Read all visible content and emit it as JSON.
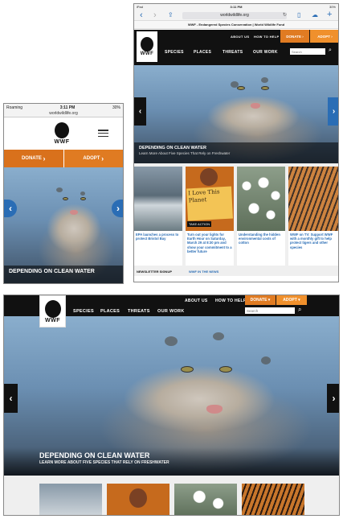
{
  "phone": {
    "status": {
      "carrier": "Roaming",
      "time": "3:11 PM",
      "battery": "30%"
    },
    "url": "worldwildlife.org",
    "logo_text": "WWF",
    "donate_label": "DONATE",
    "adopt_label": "ADOPT",
    "caption_title": "DEPENDING ON CLEAN WATER"
  },
  "tablet": {
    "status": {
      "device": "iPad",
      "time": "3:11 PM",
      "battery": "30%"
    },
    "url": "worldwildlife.org",
    "page_title": "WWF - Endangered Species Conservation | World Wildlife Fund",
    "top_links": [
      "ABOUT US",
      "HOW TO HELP"
    ],
    "donate_label": "DONATE",
    "adopt_label": "ADOPT",
    "nav": [
      "SPECIES",
      "PLACES",
      "THREATS",
      "OUR WORK"
    ],
    "search_placeholder": "Search",
    "logo_text": "WWF",
    "caption_title": "DEPENDING ON CLEAN WATER",
    "caption_sub": "Learn More About Five Species That Rely on Freshwater",
    "news": [
      {
        "text": "EPA launches a process to protect Bristol Bay"
      },
      {
        "text": "Turn out your lights for Earth Hour on Saturday, March 29 at 8:30 pm and show your commitment to a better future",
        "sign": "I Love This Planet",
        "badge": "TAKE ACTION"
      },
      {
        "text": "Understanding the hidden environmental costs of cotton"
      },
      {
        "text": "WWF on TV: Support WWF with a monthly gift to help protect tigers and other species"
      }
    ],
    "footer_links": [
      "NEWSLETTER SIGNUP",
      "WWF IN THE NEWS"
    ]
  },
  "desktop": {
    "top_links": [
      "ABOUT US",
      "HOW TO HELP"
    ],
    "donate_label": "DONATE",
    "adopt_label": "ADOPT",
    "nav": [
      "SPECIES",
      "PLACES",
      "THREATS",
      "OUR WORK"
    ],
    "search_placeholder": "Search",
    "logo_text": "WWF",
    "caption_title": "DEPENDING ON CLEAN WATER",
    "caption_sub": "LEARN MORE ABOUT FIVE SPECIES THAT RELY ON FRESHWATER"
  },
  "colors": {
    "orange": "#e07b22",
    "blue_link": "#2a6db5",
    "nav_bg": "#111111"
  }
}
